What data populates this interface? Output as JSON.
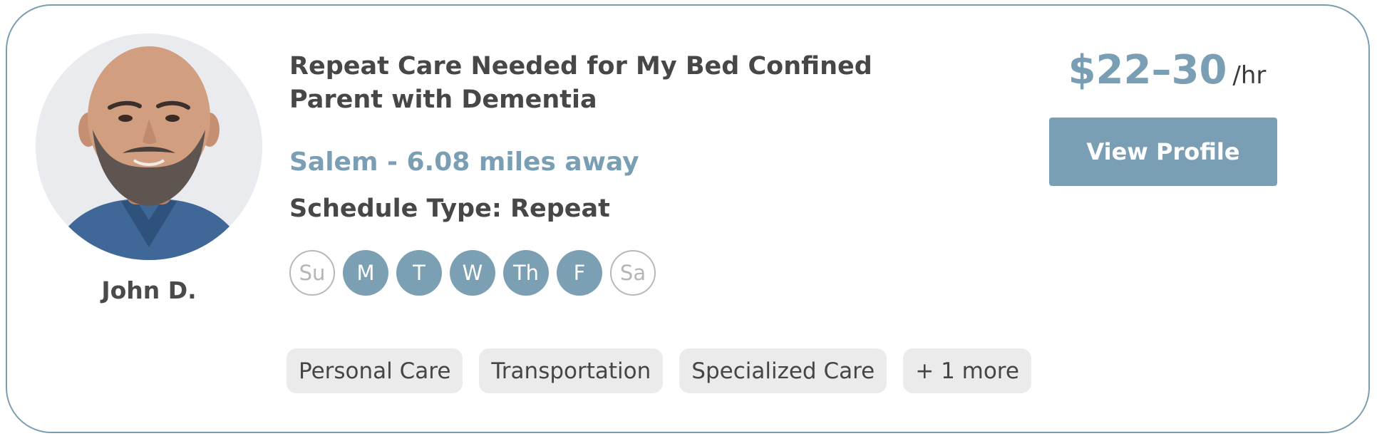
{
  "caregiver": {
    "name": "John D.",
    "avatar_icon": "person-photo"
  },
  "job": {
    "title": "Repeat Care Needed for My Bed Confined Parent with Dementia",
    "location": "Salem - 6.08 miles away",
    "schedule": "Schedule Type: Repeat"
  },
  "days": [
    {
      "label": "Su",
      "active": false
    },
    {
      "label": "M",
      "active": true
    },
    {
      "label": "T",
      "active": true
    },
    {
      "label": "W",
      "active": true
    },
    {
      "label": "Th",
      "active": true
    },
    {
      "label": "F",
      "active": true
    },
    {
      "label": "Sa",
      "active": false
    }
  ],
  "tags": [
    "Personal Care",
    "Transportation",
    "Specialized Care",
    "+ 1 more"
  ],
  "price": {
    "value": "$22–30",
    "unit": "/hr"
  },
  "actions": {
    "view_profile_label": "View Profile"
  },
  "colors": {
    "accent": "#7a9fb4",
    "card_border": "#7c9db0",
    "text_dark": "#474747",
    "tag_bg": "#ebebeb",
    "inactive_day": "#b5b5b5"
  }
}
